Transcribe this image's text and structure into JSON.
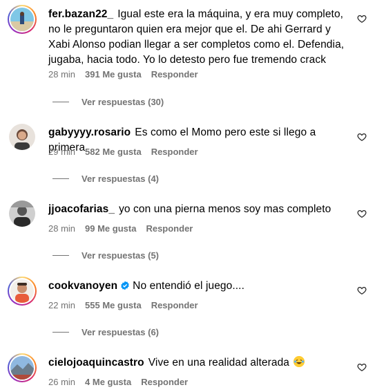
{
  "comments": [
    {
      "username": "fer.bazan22_",
      "text": "Igual este era la máquina, y era muy completo, no le preguntaron quien era mejor que el. De ahi Gerrard y Xabi Alonso podian llegar a ser completos como el. Defendia, jugaba, hacia todo. Yo lo detesto pero fue tremendo crack",
      "time": "28 min",
      "likes": "391 Me gusta",
      "reply_label": "Responder",
      "view_replies": "Ver respuestas (30)"
    },
    {
      "username": "gabyyyy.rosario",
      "text": "Es como el Momo pero este si llego a primera",
      "time": "29 min",
      "likes": "582 Me gusta",
      "reply_label": "Responder",
      "view_replies": "Ver respuestas (4)"
    },
    {
      "username": "jjoacofarias_",
      "text": "yo con una pierna menos soy mas completo",
      "time": "28 min",
      "likes": "99 Me gusta",
      "reply_label": "Responder",
      "view_replies": "Ver respuestas (5)"
    },
    {
      "username": "cookvanoyen",
      "text": "No entendió el juego....",
      "time": "22 min",
      "likes": "555 Me gusta",
      "reply_label": "Responder",
      "view_replies": "Ver respuestas (6)"
    },
    {
      "username": "cielojoaquincastro",
      "text": "Vive en una realidad alterada",
      "time": "26 min",
      "likes": "4 Me gusta",
      "reply_label": "Responder"
    }
  ],
  "colors": {
    "secondary_text": "#737373",
    "verified": "#0095f6",
    "ring_gradient": [
      "#feda75",
      "#fa7e1e",
      "#d62976",
      "#962fbf",
      "#4f5bd5"
    ]
  },
  "icons": {
    "like": "heart-outline-icon",
    "verified": "verified-badge-icon",
    "emoji": "laughing-tears-emoji"
  }
}
